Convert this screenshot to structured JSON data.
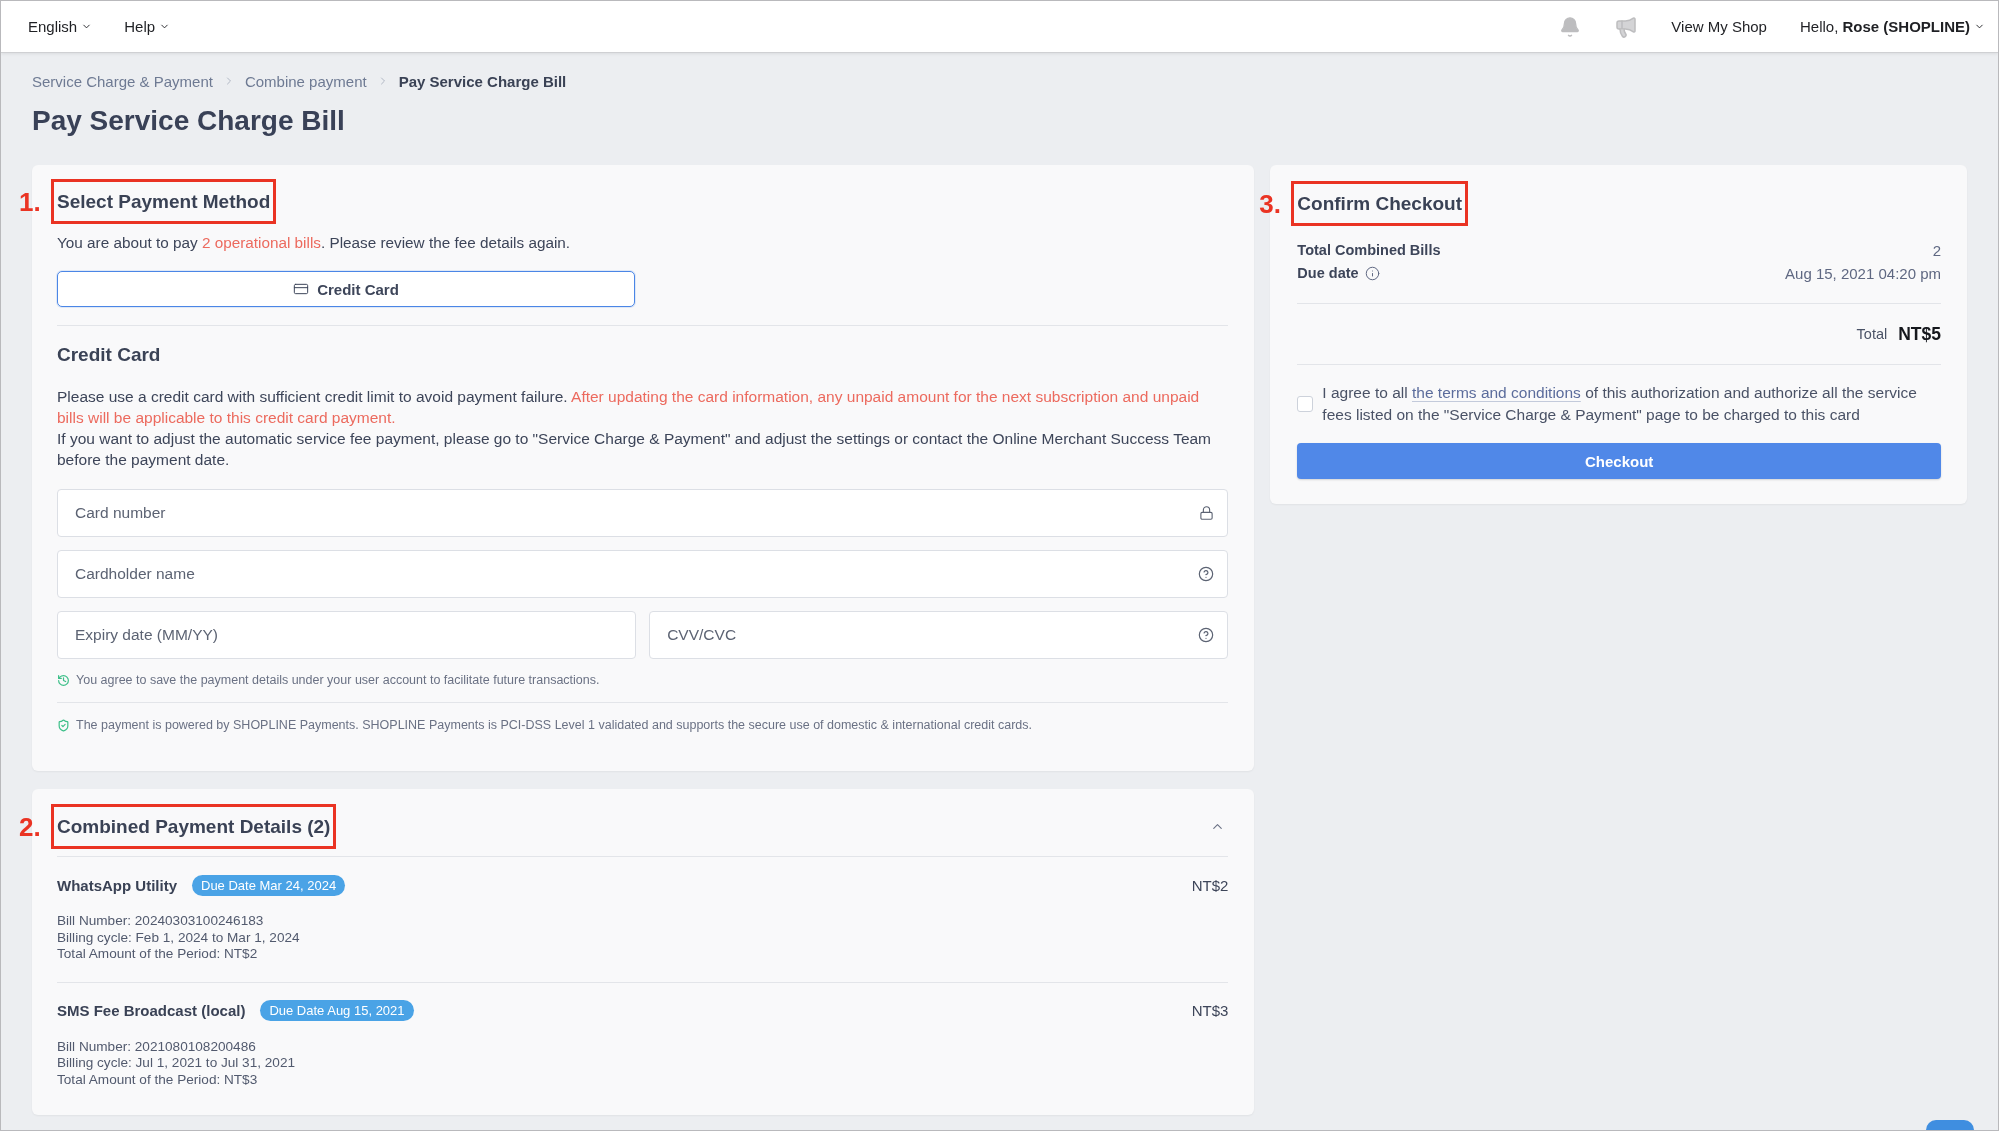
{
  "top_bar": {
    "menus": [
      {
        "label": "English"
      },
      {
        "label": "Help"
      }
    ],
    "shop_link": "View My Shop",
    "user_menu": "Hello, **Rose (SHOPLINE)**"
  },
  "breadcrumb": [
    {
      "label": "Service Charge & Payment",
      "current": false
    },
    {
      "label": "Combine payment",
      "current": false
    },
    {
      "label": "Pay Service Charge Bill",
      "current": true
    }
  ],
  "page_title": "Pay Service Charge Bill",
  "payment_method": {
    "step": "1.",
    "title": "Select Payment Method",
    "intro": {
      "before": "You are about to pay ",
      "highlight": "2 operational bills",
      "after": ". Please review the fee details again."
    },
    "methods": [
      {
        "label": "Credit Card",
        "selected": true
      }
    ],
    "form_title": "Credit Card",
    "notice": {
      "text": "Please use a credit card with sufficient credit limit to avoid payment failure. ",
      "warning": "After updating the card information, any unpaid amount for the next subscription and unpaid bills will be applicable to this credit card payment."
    },
    "adjust_note": "If you want to adjust the automatic service fee payment, please go to \"Service Charge & Payment\" and adjust the settings or contact the Online Merchant Success Team before the payment date.",
    "field_rows": [
      [
        {
          "placeholder": "Card number",
          "kind": "secure"
        }
      ],
      [
        {
          "placeholder": "Cardholder name",
          "kind": "hint"
        }
      ],
      [
        {
          "placeholder": "Expiry date (MM/YY)",
          "kind": "plain"
        },
        {
          "placeholder": "CVV/CVC",
          "kind": "hint"
        }
      ]
    ],
    "save_note": "You agree to save the payment details under your user account to facilitate future transactions.",
    "security_note": "The payment is powered by SHOPLINE Payments. SHOPLINE Payments is PCI-DSS Level 1 validated and supports the secure use of domestic & international credit cards."
  },
  "payment_details": {
    "step": "2.",
    "title": "Combined Payment Details (2)",
    "expanded": true,
    "bills": [
      {
        "name": "WhatsApp Utility",
        "badge": "Due Date Mar 24, 2024",
        "amount": "NT$2",
        "details": [
          "Bill Number: 20240303100246183",
          "Billing cycle: Feb 1, 2024 to Mar 1, 2024",
          "Total Amount of the Period: NT$2"
        ]
      },
      {
        "name": "SMS Fee Broadcast (local)",
        "badge": "Due Date Aug 15, 2021",
        "amount": "NT$3",
        "details": [
          "Bill Number: 2021080108200486",
          "Billing cycle: Jul 1, 2021 to Jul 31, 2021",
          "Total Amount of the Period: NT$3"
        ]
      }
    ]
  },
  "checkout": {
    "step": "3.",
    "title": "Confirm Checkout",
    "summary": [
      {
        "label": "Total Combined Bills",
        "value": "2",
        "info": false
      },
      {
        "label": "Due date",
        "value": "Aug 15, 2021 04:20 pm",
        "info": true
      }
    ],
    "total_label": "Total",
    "total_value": "NT$5",
    "agreement": {
      "checked": false,
      "before": "I agree to all ",
      "link": "the terms and conditions",
      "after": " of this authorization and authorize all the service fees listed on the \"Service Charge & Payment\" page to be charged to this card"
    },
    "button": "Checkout"
  }
}
